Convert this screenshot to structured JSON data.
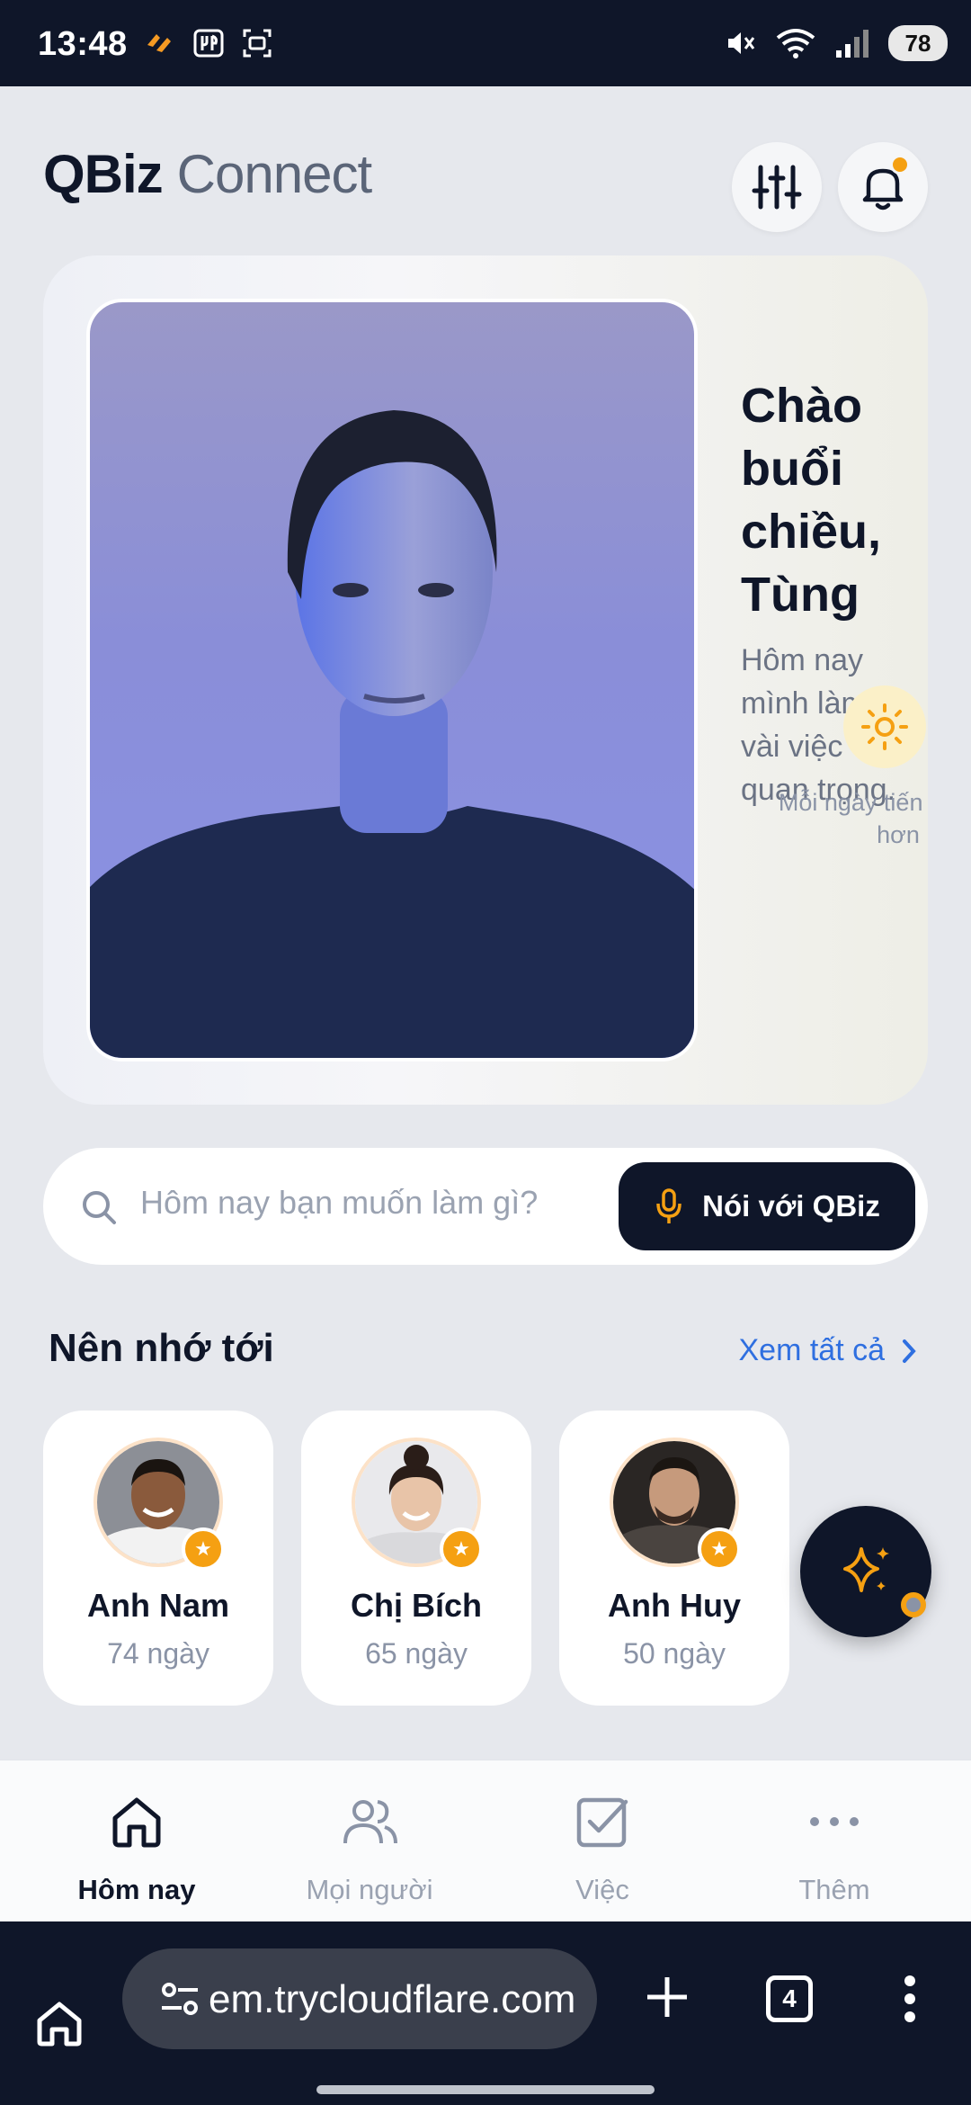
{
  "status_bar": {
    "time": "13:48",
    "battery": "78",
    "icons_left": [
      "app-notification-icon",
      "restaurant-icon",
      "screenshot-icon"
    ],
    "icons_right": [
      "mute-icon",
      "wifi-icon",
      "signal-icon"
    ]
  },
  "header": {
    "brand_primary": "QBiz",
    "brand_secondary": "Connect",
    "notification_dot_color": "#f5a012"
  },
  "hero": {
    "greeting": "Chào buổi chiều, Tùng",
    "subtitle": "Hôm nay mình làm vài việc quan trọng.",
    "tagline": "Mỗi ngày tiến bộ hơn ✨"
  },
  "search": {
    "placeholder": "Hôm nay bạn muốn làm gì?",
    "voice_button": "Nói với QBiz"
  },
  "section": {
    "title": "Nên nhớ tới",
    "see_all": "Xem tất cả"
  },
  "contacts": [
    {
      "name": "Anh Nam",
      "days": "74 ngày"
    },
    {
      "name": "Chị Bích",
      "days": "65 ngày"
    },
    {
      "name": "Anh Huy",
      "days": "50 ngày"
    }
  ],
  "bottom_nav": [
    {
      "label": "Hôm nay",
      "active": true
    },
    {
      "label": "Mọi người",
      "active": false
    },
    {
      "label": "Việc",
      "active": false
    },
    {
      "label": "Thêm",
      "active": false
    }
  ],
  "browser": {
    "url": "em.trycloudflare.com",
    "tab_count": "4"
  },
  "colors": {
    "navy": "#0f1629",
    "accent_orange": "#f5a012",
    "link_blue": "#2f6fe0",
    "background": "#e6e8ed"
  }
}
